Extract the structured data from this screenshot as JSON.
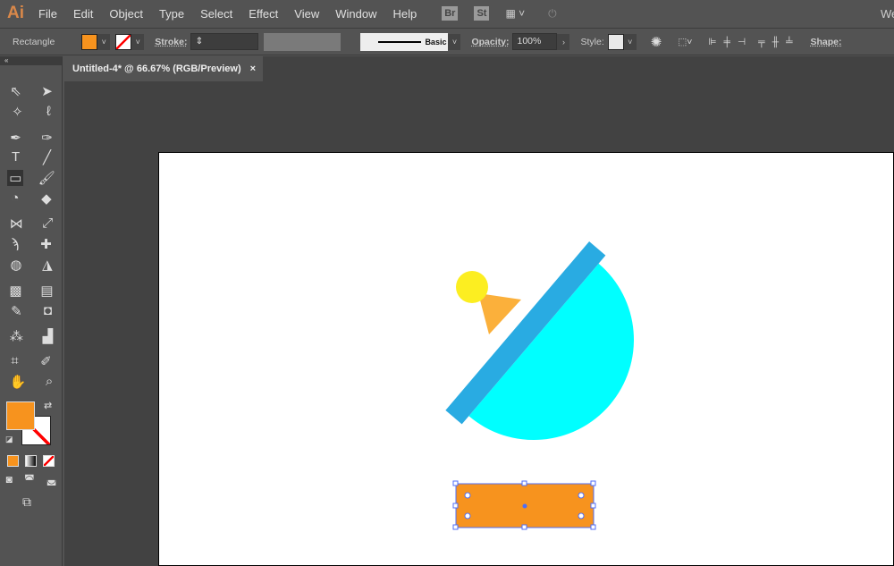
{
  "app": {
    "logo": "Ai",
    "menus": [
      "File",
      "Edit",
      "Object",
      "Type",
      "Select",
      "Effect",
      "View",
      "Window",
      "Help"
    ],
    "bridge": "Br",
    "stock": "St",
    "workspace": "We"
  },
  "control": {
    "tool": "Rectangle",
    "fill_color": "#F7931E",
    "stroke_label": "Stroke:",
    "brush": "Basic",
    "opacity_label": "Opacity:",
    "opacity": "100%",
    "style_label": "Style:",
    "shape_label": "Shape:"
  },
  "document": {
    "tab": "Untitled-4* @ 66.67% (RGB/Preview)",
    "close": "×"
  },
  "colors": {
    "blue": "#29ABE2",
    "cyan": "#00FFFF",
    "yellow": "#FCEE21",
    "light_orange": "#FBB03B",
    "orange": "#F7931E",
    "selection": "#4F6EF7"
  },
  "tools": [
    "selection",
    "direct-selection",
    "magic-wand",
    "lasso",
    "pen",
    "curvature",
    "type",
    "line",
    "rectangle",
    "paintbrush",
    "shaper",
    "eraser",
    "reflect",
    "scale",
    "warp",
    "pin",
    "shape-builder",
    "perspective",
    "mesh",
    "gradient",
    "eyedropper",
    "blend",
    "symbol-sprayer",
    "graph",
    "artboard",
    "slice",
    "hand",
    "zoom"
  ]
}
